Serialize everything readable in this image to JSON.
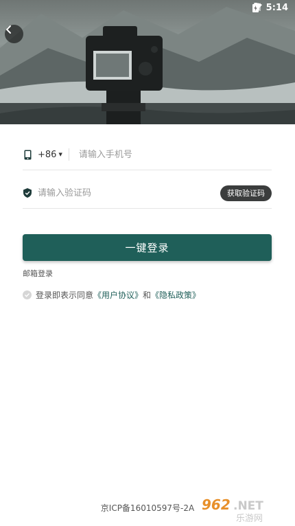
{
  "status_bar": {
    "time": "5:14"
  },
  "form": {
    "country_code": "+86",
    "phone_placeholder": "请输入手机号",
    "code_placeholder": "请输入验证码",
    "get_code_label": "获取验证码"
  },
  "login_button_label": "一键登录",
  "email_login_label": "邮箱登录",
  "agreement": {
    "prefix": "登录即表示同意",
    "user_agreement": "《用户协议》",
    "and": "和",
    "privacy_policy": "《隐私政策》"
  },
  "footer": {
    "icp": "京ICP备16010597号-2A"
  },
  "watermark": {
    "main": "962.NET",
    "sub": "乐游网"
  },
  "colors": {
    "accent": "#1f5f59",
    "button_dark": "#3b3d3d"
  },
  "icons": {
    "back": "back-arrow-icon",
    "phone": "phone-icon",
    "shield": "shield-check-icon",
    "wifi": "wifi-icon",
    "signal": "signal-icon",
    "battery": "battery-icon"
  }
}
